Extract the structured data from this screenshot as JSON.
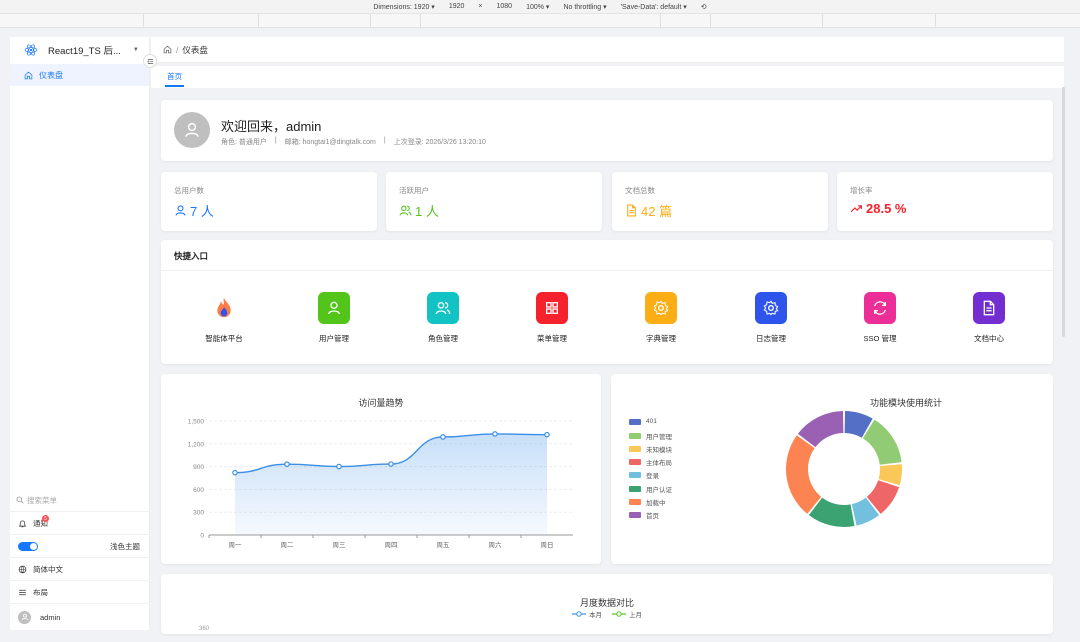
{
  "devtools": {
    "dimensions": "Dimensions: 1920",
    "width": "1920",
    "times": "×",
    "height": "1080",
    "zoom": "100%",
    "throttling": "No throttling",
    "save_data": "'Save-Data': default"
  },
  "sidebar": {
    "brand": "React19_TS 后...",
    "nav_items": [
      {
        "label": "仪表盘",
        "active": true
      }
    ],
    "search_placeholder": "搜索菜单",
    "notify_label": "通知",
    "notify_count": "5",
    "theme_label": "浅色主题",
    "language_label": "简体中文",
    "layout_label": "布局",
    "user_name": "admin"
  },
  "header": {
    "breadcrumb": [
      "仪表盘"
    ],
    "separator": "/"
  },
  "tabs": [
    {
      "label": "首页",
      "active": true
    }
  ],
  "welcome": {
    "title": "欢迎回来，admin",
    "role": "角色: 普通用户",
    "divider": "|",
    "email": "邮箱: hongtai1@dingtalk.com",
    "last_login": "上次登录: 2026/3/26 13:20:10"
  },
  "stats": [
    {
      "label": "总用户数",
      "value": "7 人",
      "color": "#1677ff",
      "icon": "user-icon"
    },
    {
      "label": "活跃用户",
      "value": "1 人",
      "color": "#52c41a",
      "icon": "users-icon"
    },
    {
      "label": "文档总数",
      "value": "42 篇",
      "color": "#faad14",
      "icon": "document-icon"
    },
    {
      "label": "增长率",
      "value": "28.5 %",
      "color": "#f5222d",
      "icon": "trend-up-icon"
    }
  ],
  "quick_access": {
    "title": "快捷入口",
    "items": [
      {
        "label": "智能体平台",
        "color": "#ffffff",
        "icon": "flame-icon"
      },
      {
        "label": "用户管理",
        "color": "#52c41a",
        "icon": "user-icon"
      },
      {
        "label": "角色管理",
        "color": "#13c2c2",
        "icon": "users-icon"
      },
      {
        "label": "菜单管理",
        "color": "#f5222d",
        "icon": "grid-icon"
      },
      {
        "label": "字典管理",
        "color": "#faad14",
        "icon": "gear-icon"
      },
      {
        "label": "日志管理",
        "color": "#2f54eb",
        "icon": "gear-icon"
      },
      {
        "label": "SSO 管理",
        "color": "#eb2f96",
        "icon": "refresh-icon"
      },
      {
        "label": "文档中心",
        "color": "#722ed1",
        "icon": "document-icon"
      }
    ]
  },
  "chart_data": [
    {
      "type": "area",
      "title": "访问量趋势",
      "categories": [
        "周一",
        "周二",
        "周三",
        "周四",
        "周五",
        "周六",
        "周日"
      ],
      "series": [
        {
          "values": [
            820,
            932,
            901,
            934,
            1290,
            1330,
            1320
          ]
        }
      ],
      "ylim": [
        0,
        1500
      ],
      "yticks": [
        "0",
        "300",
        "600",
        "900",
        "1,200",
        "1,500"
      ],
      "grid": true,
      "color": "#3a8ee6"
    },
    {
      "type": "pie",
      "title": "功能模块使用统计",
      "legend_position": "left",
      "slices": [
        {
          "label": "401",
          "value": 8,
          "color": "#5470c6"
        },
        {
          "label": "用户管理",
          "value": 14,
          "color": "#91cc75"
        },
        {
          "label": "未知模块",
          "value": 6,
          "color": "#fac858"
        },
        {
          "label": "主体布局",
          "value": 9,
          "color": "#ee6666"
        },
        {
          "label": "登录",
          "value": 7,
          "color": "#73c0de"
        },
        {
          "label": "用户认证",
          "value": 13,
          "color": "#3ba272"
        },
        {
          "label": "加载中",
          "value": 23,
          "color": "#fc8452"
        },
        {
          "label": "首页",
          "value": 14,
          "color": "#9a60b4"
        }
      ]
    },
    {
      "type": "line",
      "title": "月度数据对比",
      "series": [
        {
          "name": "本月",
          "color": "#3a8ee6"
        },
        {
          "name": "上月",
          "color": "#52c41a"
        }
      ],
      "yticks": [
        "360"
      ]
    }
  ]
}
